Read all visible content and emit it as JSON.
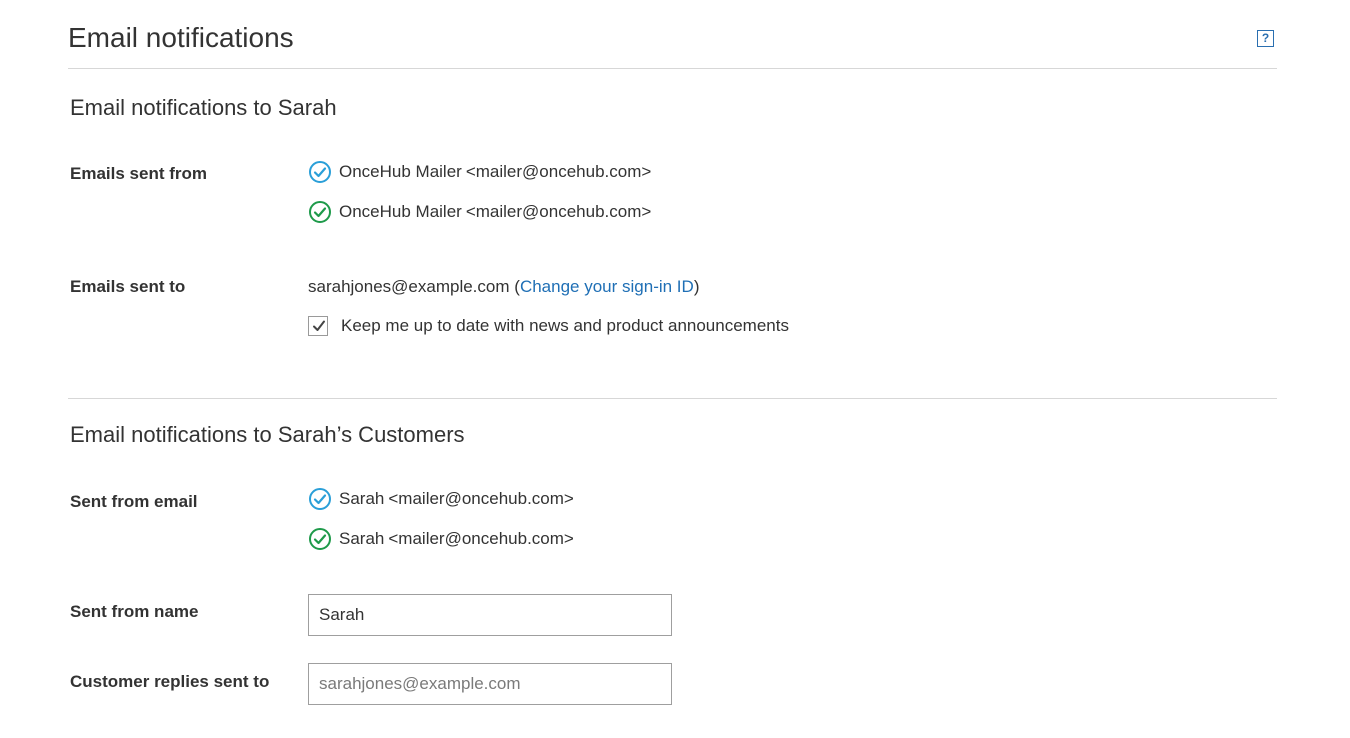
{
  "header": {
    "title": "Email notifications",
    "help_label": "?"
  },
  "section_user": {
    "title": "Email notifications to Sarah",
    "emails_from_label": "Emails sent from",
    "senders": [
      {
        "icon": "pending-check-icon",
        "color": "#2a9fd8",
        "name": "OnceHub Mailer",
        "address": "<mailer@oncehub.com>"
      },
      {
        "icon": "verified-check-icon",
        "color": "#1e9a4a",
        "name": "OnceHub Mailer",
        "address": "<mailer@oncehub.com>"
      }
    ],
    "emails_to_label": "Emails sent to",
    "email": "sarahjones@example.com",
    "open_paren": "(",
    "change_link": "Change your sign-in ID",
    "close_paren": ")",
    "newsletter_checked": true,
    "newsletter_label": "Keep me up to date with news and product announcements"
  },
  "section_customers": {
    "title": "Email notifications to Sarah’s Customers",
    "from_email_label": "Sent from email",
    "senders": [
      {
        "icon": "pending-check-icon",
        "color": "#2a9fd8",
        "name": "Sarah",
        "address": "<mailer@oncehub.com>"
      },
      {
        "icon": "verified-check-icon",
        "color": "#1e9a4a",
        "name": "Sarah",
        "address": "<mailer@oncehub.com>"
      }
    ],
    "from_name_label": "Sent from name",
    "from_name_value": "Sarah",
    "replies_label": "Customer replies sent to",
    "replies_placeholder": "sarahjones@example.com"
  },
  "colors": {
    "link": "#1f6fb5",
    "pending": "#2a9fd8",
    "verified": "#1e9a4a"
  }
}
